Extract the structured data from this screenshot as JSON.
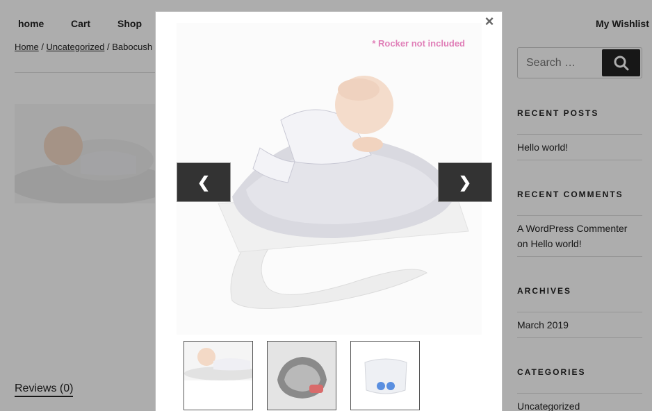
{
  "nav": {
    "items": [
      "home",
      "Cart",
      "Shop"
    ],
    "wishlist": "My Wishlist"
  },
  "breadcrumb": {
    "home": "Home",
    "category": "Uncategorized",
    "current": "Babocush"
  },
  "tabs": {
    "reviews": "Reviews (0)"
  },
  "sidebar": {
    "search": {
      "placeholder": "Search …"
    },
    "recent_posts": {
      "title": "RECENT POSTS",
      "items": [
        "Hello world!"
      ]
    },
    "recent_comments": {
      "title": "RECENT COMMENTS",
      "author": "A WordPress Commenter",
      "on": "on",
      "post": "Hello world!"
    },
    "archives": {
      "title": "ARCHIVES",
      "items": [
        "March 2019"
      ]
    },
    "categories": {
      "title": "CATEGORIES",
      "items": [
        "Uncategorized"
      ]
    }
  },
  "modal": {
    "close": "×",
    "note": "* Rocker not included",
    "prev": "❮",
    "next": "❯",
    "thumbnails": [
      "baby-on-cushion",
      "grey-cushion",
      "white-cushion"
    ]
  },
  "colors": {
    "note_pink": "#e07fb8",
    "arrow_bg": "#333333",
    "dark_button": "#222222"
  }
}
